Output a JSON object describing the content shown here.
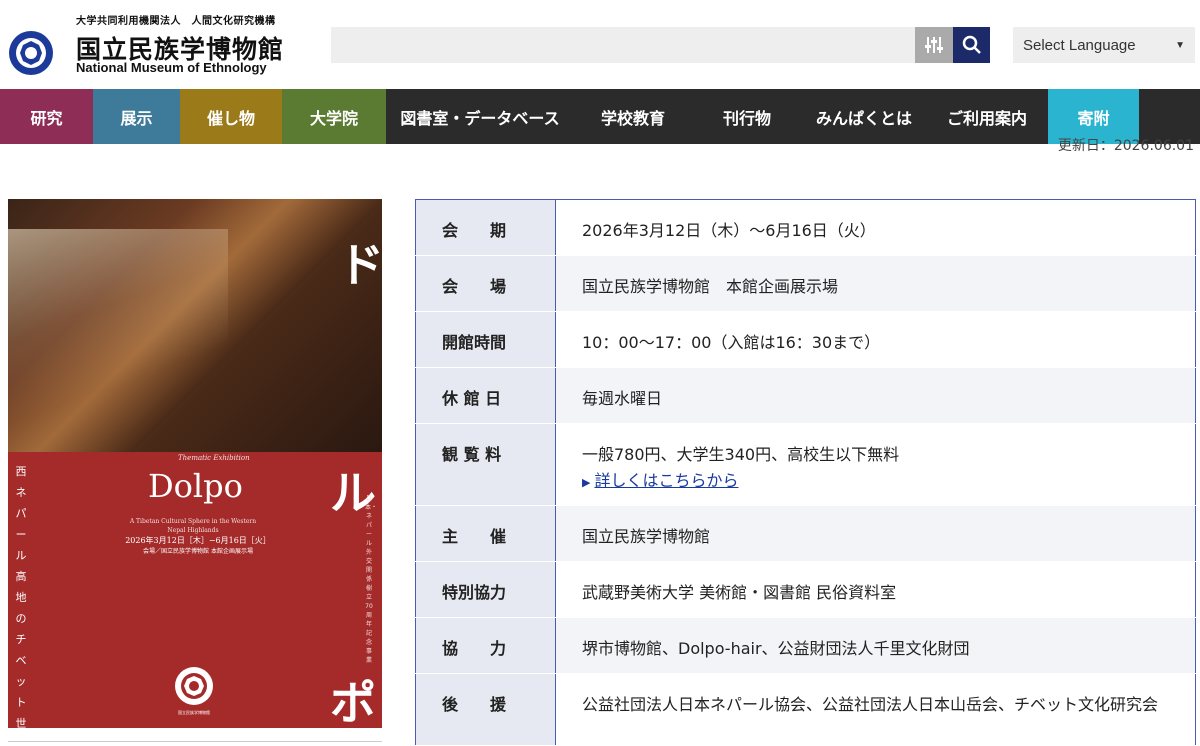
{
  "header": {
    "org_sub": "大学共同利用機関法人　人間文化研究機構",
    "org_name_ja": "国立民族学博物館",
    "org_name_en": "National Museum of Ethnology",
    "search": {
      "placeholder": ""
    },
    "filter_icon": "sliders-icon",
    "search_icon": "magnifier-icon",
    "language_select": {
      "selected": "Select Language"
    }
  },
  "nav": {
    "items": [
      {
        "label": "研究",
        "color": "#8e2d55"
      },
      {
        "label": "展示",
        "color": "#3e7a99"
      },
      {
        "label": "催し物",
        "color": "#9b7a1a"
      },
      {
        "label": "大学院",
        "color": "#5b7a32"
      },
      {
        "label": "図書室・データベース",
        "color": "#2b2b2b"
      },
      {
        "label": "学校教育",
        "color": "#2b2b2b"
      },
      {
        "label": "刊行物",
        "color": "#2b2b2b"
      },
      {
        "label": "みんぱくとは",
        "color": "#2b2b2b"
      },
      {
        "label": "ご利用案内",
        "color": "#2b2b2b"
      },
      {
        "label": "寄附",
        "color": "#2bb4cf"
      }
    ]
  },
  "update_date": "更新日：2026.06.01",
  "poster": {
    "char_top": "ド",
    "char_mid": "ル",
    "char_bottom": "ポ",
    "kicker": "Thematic Exhibition",
    "title": "Dolpo",
    "subtitle": "A Tibetan Cultural Sphere in the Western Nepal Highlands",
    "dates": "2026年3月12日［木］−6月16日［火］",
    "venue": "会場／国立民族学博物館 本館企画展示場",
    "vertical_left": "西ネパール高地のチベット世界",
    "vertical_right": "日本・ネパール外交関係樹立70周年記念事業"
  },
  "info": {
    "rows": [
      {
        "label": "会　　期",
        "value": "2026年3月12日（木）～6月16日（火）"
      },
      {
        "label": "会　　場",
        "value": "国立民族学博物館　本館企画展示場"
      },
      {
        "label": "開館時間",
        "value": "10：00～17：00（入館は16：30まで）"
      },
      {
        "label": "休 館 日",
        "value": "毎週水曜日"
      },
      {
        "label": "観 覧 料",
        "value": "一般780円、大学生340円、高校生以下無料",
        "link": "詳しくはこちらから"
      },
      {
        "label": "主　　催",
        "value": "国立民族学博物館"
      },
      {
        "label": "特別協力",
        "value": "武蔵野美術大学 美術館・図書館 民俗資料室"
      },
      {
        "label": "協　　力",
        "value": "堺市博物館、Dolpo-hair、公益財団法人千里文化財団"
      },
      {
        "label": "後　　援",
        "value": "公益社団法人日本ネパール協会、公益社団法人日本山岳会、チベット文化研究会"
      }
    ]
  },
  "colors": {
    "accent": "#1c2a6a",
    "table_border": "#4a5bb0",
    "poster_red": "#a52a2a"
  }
}
